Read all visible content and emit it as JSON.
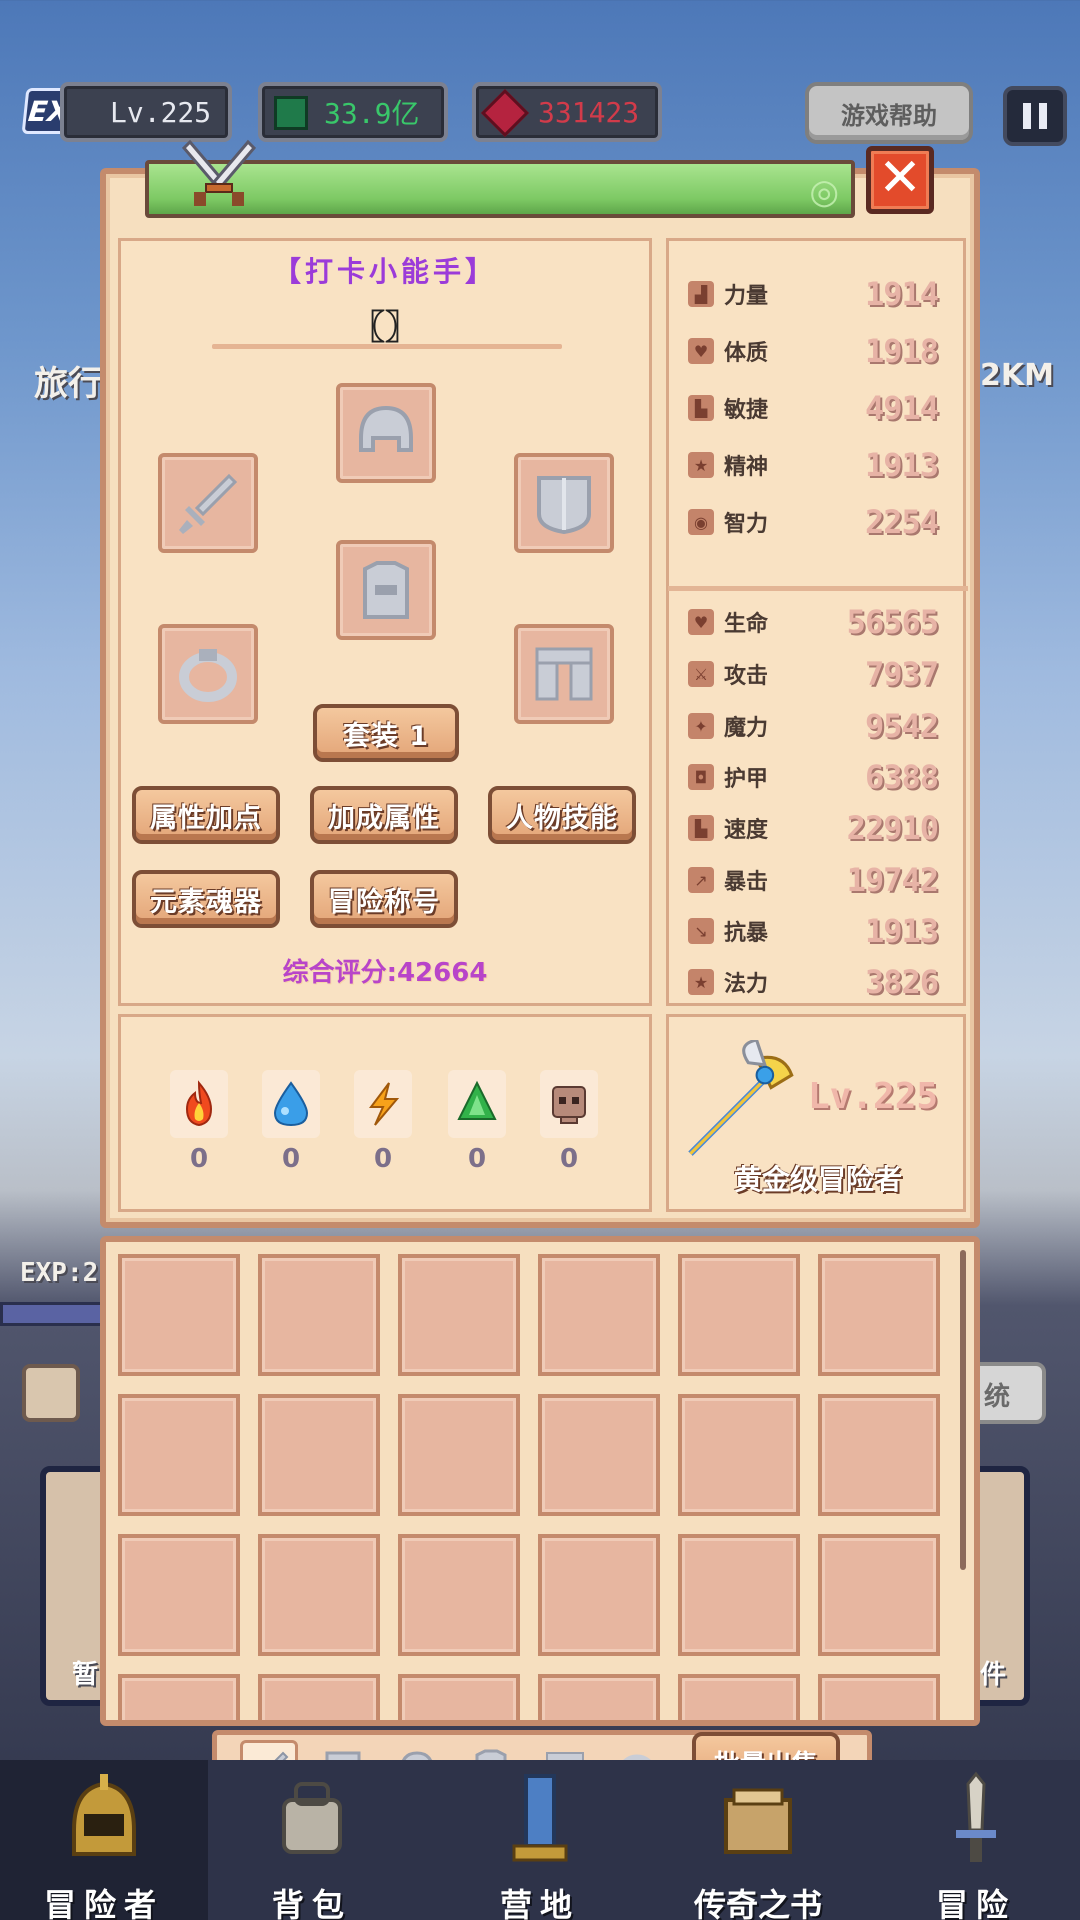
{
  "top": {
    "exp_badge": "EXP",
    "level": "Lv.225",
    "gold": "33.9亿",
    "gems": "331423",
    "help_label": "游戏帮助",
    "colors": {
      "gold_text": "#39c76a",
      "gem_text": "#d23b4a"
    }
  },
  "background": {
    "left_text": "旅行",
    "right_text": "2KM",
    "exp_text": "EXP:2",
    "side_left_text": "暂",
    "side_right_text": "件",
    "system_text": "统"
  },
  "character": {
    "title": "【打卡小能手】",
    "title_icon": "〖〗",
    "set_button": "套装 1",
    "buttons": [
      "属性加点",
      "加成属性",
      "人物技能",
      "元素魂器",
      "冒险称号"
    ],
    "score": "综合评分:42664",
    "slots": [
      "helmet-icon",
      "sword-icon",
      "shield-icon",
      "armor-icon",
      "ring-icon",
      "boots-icon"
    ]
  },
  "elements": [
    {
      "icon": "fire-icon",
      "value": "0"
    },
    {
      "icon": "water-icon",
      "value": "0"
    },
    {
      "icon": "lightning-icon",
      "value": "0"
    },
    {
      "icon": "earth-icon",
      "value": "0"
    },
    {
      "icon": "skull-icon",
      "value": "0"
    }
  ],
  "base_stats": [
    {
      "name": "力量",
      "value": "1914"
    },
    {
      "name": "体质",
      "value": "1918"
    },
    {
      "name": "敏捷",
      "value": "4914"
    },
    {
      "name": "精神",
      "value": "1913"
    },
    {
      "name": "智力",
      "value": "2254"
    }
  ],
  "combat_stats": [
    {
      "name": "生命",
      "value": "56565"
    },
    {
      "name": "攻击",
      "value": "7937"
    },
    {
      "name": "魔力",
      "value": "9542"
    },
    {
      "name": "护甲",
      "value": "6388"
    },
    {
      "name": "速度",
      "value": "22910"
    },
    {
      "name": "暴击",
      "value": "19742"
    },
    {
      "name": "抗暴",
      "value": "1913"
    },
    {
      "name": "法力",
      "value": "3826"
    }
  ],
  "profile": {
    "level": "Lv.225",
    "rank": "黄金级冒险者"
  },
  "inventory": {
    "batch_sell": "批量出售",
    "tabs": [
      "sword-icon",
      "shield-icon",
      "helmet-icon",
      "armor-icon",
      "boots-icon",
      "ring-icon"
    ]
  },
  "nav": [
    {
      "label": "冒险者",
      "icon": "adventurer-icon"
    },
    {
      "label": "背包",
      "icon": "backpack-icon"
    },
    {
      "label": "营地",
      "icon": "camp-icon"
    },
    {
      "label": "传奇之书",
      "icon": "book-icon"
    },
    {
      "label": "冒险",
      "icon": "adventure-icon"
    }
  ]
}
